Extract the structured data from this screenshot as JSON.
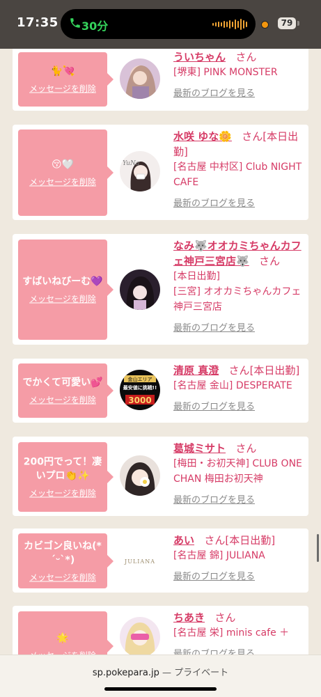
{
  "status_bar": {
    "time": "17:35",
    "call_duration": "30分",
    "battery": "79"
  },
  "common": {
    "delete_label": "メッセージを削除",
    "blog_label": "最新のブログを見る",
    "san_label": "さん"
  },
  "items": [
    {
      "message": "🐈💘",
      "name": "ういちゃん",
      "status": "",
      "shop": "[堺東] PINK MONSTER"
    },
    {
      "message": "😚🤍",
      "name": "水咲 ゆな🌼",
      "status": "[本日出勤]",
      "shop": "[名古屋 中村区] Club NIGHT CAFE"
    },
    {
      "message": "すばいねびーむ💜",
      "name": "なみ🐺オオカミちゃんカフェ神戸三宮店🐺",
      "status": "[本日出勤]",
      "shop": "[三宮] オオカミちゃんカフェ神戸三宮店"
    },
    {
      "message": "でかくて可愛い💕",
      "name": "清原 真澄",
      "status": "[本日出勤]",
      "shop": "[名古屋 金山] DESPERATE"
    },
    {
      "message": "200円でって！凄いプロ👏✨",
      "name": "葛城ミサト",
      "status": "",
      "shop": "[梅田・お初天神] CLUB ONE CHAN 梅田お初天神"
    },
    {
      "message": "カビゴン良いね(*´ᵕ`*)",
      "name": "あい",
      "status": "[本日出勤]",
      "shop": "[名古屋 錦] JULIANA"
    },
    {
      "message": "🌟",
      "name": "ちあき",
      "status": "",
      "shop": "[名古屋 栄] minis cafe ＋"
    }
  ],
  "avatar_texts": {
    "yuna": "YuNa",
    "desperate_top": "金山エリア",
    "desperate_mid": "最安値に挑戦!!",
    "desperate_price": "3000",
    "juliana": "JULIANA"
  },
  "bottom_bar": {
    "domain": "sp.pokepara.jp",
    "separator": "—",
    "privacy": "プライベート"
  }
}
